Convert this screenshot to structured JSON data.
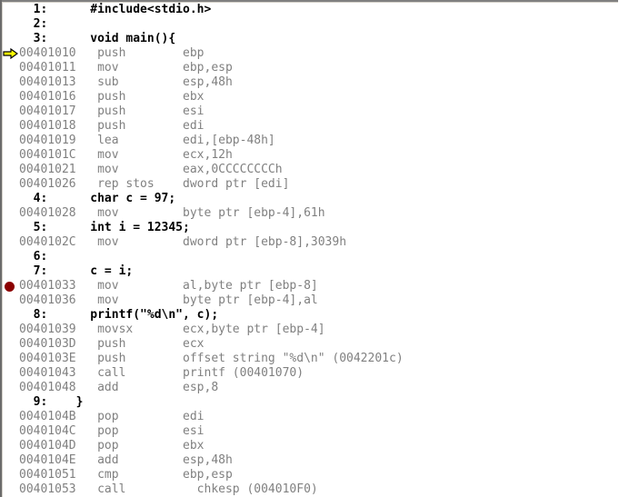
{
  "window": {
    "name": "disassembly-view",
    "background_color": "#ffffff",
    "source_text_color": "#000000",
    "asm_text_color": "#808080",
    "breakpoint_color": "#8b0000",
    "instruction_pointer_color": "#ffff00"
  },
  "gutter": {
    "breakpoint_icon": "breakpoint-dot-icon",
    "instruction_pointer_icon": "instruction-pointer-arrow-icon"
  },
  "lines": [
    {
      "kind": "src",
      "marker": "none",
      "text": "  1:      #include<stdio.h>"
    },
    {
      "kind": "src",
      "marker": "none",
      "text": "  2:"
    },
    {
      "kind": "src",
      "marker": "none",
      "text": "  3:      void main(){"
    },
    {
      "kind": "asm",
      "marker": "ip",
      "text": "00401010   push        ebp"
    },
    {
      "kind": "asm",
      "marker": "none",
      "text": "00401011   mov         ebp,esp"
    },
    {
      "kind": "asm",
      "marker": "none",
      "text": "00401013   sub         esp,48h"
    },
    {
      "kind": "asm",
      "marker": "none",
      "text": "00401016   push        ebx"
    },
    {
      "kind": "asm",
      "marker": "none",
      "text": "00401017   push        esi"
    },
    {
      "kind": "asm",
      "marker": "none",
      "text": "00401018   push        edi"
    },
    {
      "kind": "asm",
      "marker": "none",
      "text": "00401019   lea         edi,[ebp-48h]"
    },
    {
      "kind": "asm",
      "marker": "none",
      "text": "0040101C   mov         ecx,12h"
    },
    {
      "kind": "asm",
      "marker": "none",
      "text": "00401021   mov         eax,0CCCCCCCCh"
    },
    {
      "kind": "asm",
      "marker": "none",
      "text": "00401026   rep stos    dword ptr [edi]"
    },
    {
      "kind": "src",
      "marker": "none",
      "text": "  4:      char c = 97;"
    },
    {
      "kind": "asm",
      "marker": "none",
      "text": "00401028   mov         byte ptr [ebp-4],61h"
    },
    {
      "kind": "src",
      "marker": "none",
      "text": "  5:      int i = 12345;"
    },
    {
      "kind": "asm",
      "marker": "none",
      "text": "0040102C   mov         dword ptr [ebp-8],3039h"
    },
    {
      "kind": "src",
      "marker": "none",
      "text": "  6:"
    },
    {
      "kind": "src",
      "marker": "none",
      "text": "  7:      c = i;"
    },
    {
      "kind": "asm",
      "marker": "bp",
      "text": "00401033   mov         al,byte ptr [ebp-8]"
    },
    {
      "kind": "asm",
      "marker": "none",
      "text": "00401036   mov         byte ptr [ebp-4],al"
    },
    {
      "kind": "src",
      "marker": "none",
      "text": "  8:      printf(\"%d\\n\", c);"
    },
    {
      "kind": "asm",
      "marker": "none",
      "text": "00401039   movsx       ecx,byte ptr [ebp-4]"
    },
    {
      "kind": "asm",
      "marker": "none",
      "text": "0040103D   push        ecx"
    },
    {
      "kind": "asm",
      "marker": "none",
      "text": "0040103E   push        offset string \"%d\\n\" (0042201c)"
    },
    {
      "kind": "asm",
      "marker": "none",
      "text": "00401043   call        printf (00401070)"
    },
    {
      "kind": "asm",
      "marker": "none",
      "text": "00401048   add         esp,8"
    },
    {
      "kind": "src",
      "marker": "none",
      "text": "  9:    }"
    },
    {
      "kind": "asm",
      "marker": "none",
      "text": "0040104B   pop         edi"
    },
    {
      "kind": "asm",
      "marker": "none",
      "text": "0040104C   pop         esi"
    },
    {
      "kind": "asm",
      "marker": "none",
      "text": "0040104D   pop         ebx"
    },
    {
      "kind": "asm",
      "marker": "none",
      "text": "0040104E   add         esp,48h"
    },
    {
      "kind": "asm",
      "marker": "none",
      "text": "00401051   cmp         ebp,esp"
    },
    {
      "kind": "asm",
      "marker": "none",
      "text": "00401053   call          chkesp (004010F0)"
    }
  ]
}
